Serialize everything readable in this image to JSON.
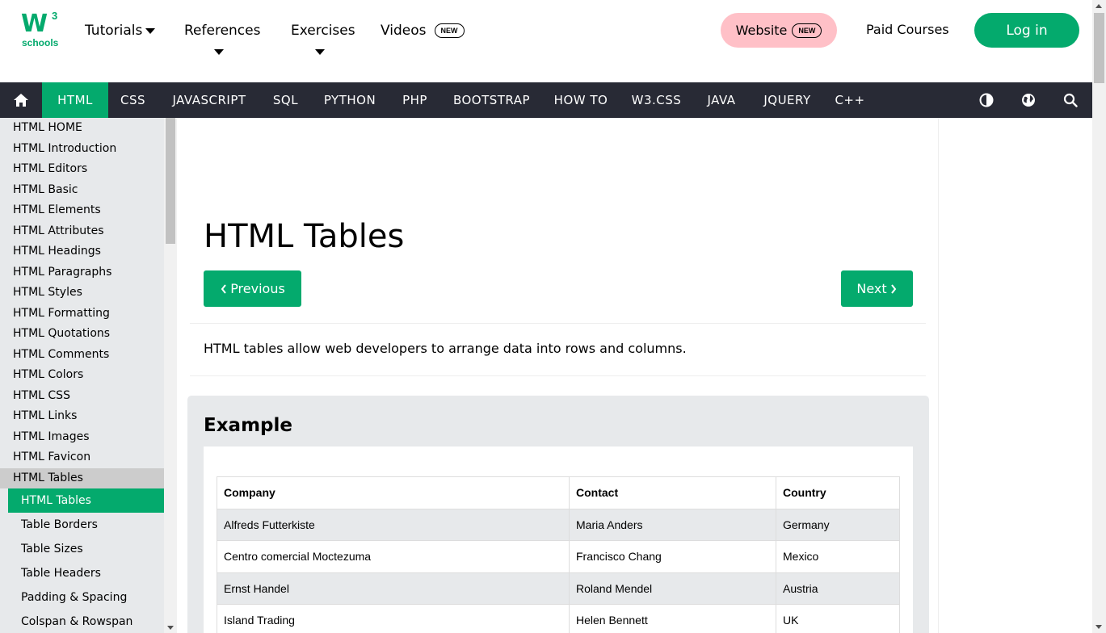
{
  "logo": {
    "main": "W",
    "sup": "3",
    "sub": "schools"
  },
  "topnav": {
    "tutorials": "Tutorials",
    "references": "References",
    "exercises": "Exercises",
    "videos": "Videos",
    "new_badge": "NEW",
    "website": "Website",
    "paid_courses": "Paid Courses",
    "login": "Log in"
  },
  "navbar": {
    "items": [
      "HTML",
      "CSS",
      "JAVASCRIPT",
      "SQL",
      "PYTHON",
      "PHP",
      "BOOTSTRAP",
      "HOW TO",
      "W3.CSS",
      "JAVA",
      "JQUERY",
      "C++"
    ],
    "active": "HTML",
    "icons": [
      "home-icon",
      "contrast-icon",
      "globe-icon",
      "search-icon"
    ]
  },
  "sidebar": {
    "items": [
      "HTML HOME",
      "HTML Introduction",
      "HTML Editors",
      "HTML Basic",
      "HTML Elements",
      "HTML Attributes",
      "HTML Headings",
      "HTML Paragraphs",
      "HTML Styles",
      "HTML Formatting",
      "HTML Quotations",
      "HTML Comments",
      "HTML Colors",
      "HTML CSS",
      "HTML Links",
      "HTML Images",
      "HTML Favicon"
    ],
    "section": "HTML Tables",
    "active": "HTML Tables",
    "subitems": [
      "Table Borders",
      "Table Sizes",
      "Table Headers",
      "Padding & Spacing",
      "Colspan & Rowspan"
    ]
  },
  "main": {
    "title": "HTML Tables",
    "previous": "Previous",
    "next": "Next",
    "intro": "HTML tables allow web developers to arrange data into rows and columns.",
    "example_title": "Example"
  },
  "table": {
    "headers": [
      "Company",
      "Contact",
      "Country"
    ],
    "rows": [
      [
        "Alfreds Futterkiste",
        "Maria Anders",
        "Germany"
      ],
      [
        "Centro comercial Moctezuma",
        "Francisco Chang",
        "Mexico"
      ],
      [
        "Ernst Handel",
        "Roland Mendel",
        "Austria"
      ],
      [
        "Island Trading",
        "Helen Bennett",
        "UK"
      ]
    ]
  },
  "colors": {
    "accent": "#04AA6D",
    "navbar": "#282A35",
    "website_pill": "#FFC0C7",
    "sidebar_bg": "#E7E9EB"
  }
}
